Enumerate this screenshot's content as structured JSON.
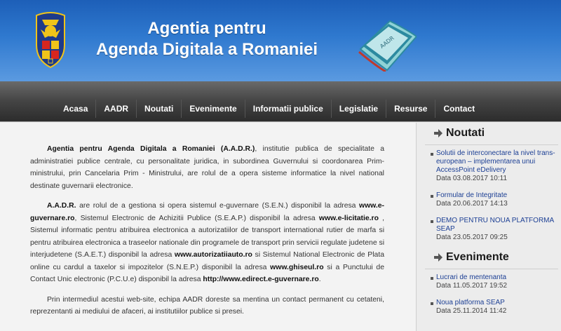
{
  "header": {
    "title_line1": "Agentia pentru",
    "title_line2": "Agenda Digitala a Romaniei",
    "logo_text": "AADR"
  },
  "nav": {
    "items": [
      "Acasa",
      "AADR",
      "Noutati",
      "Evenimente",
      "Informatii publice",
      "Legislatie",
      "Resurse",
      "Contact"
    ]
  },
  "content": {
    "p1": {
      "b1": "Agentia pentru Agenda Digitala a Romaniei (A.A.D.R.)",
      "t1": ",  institutie publica de specialitate a administratiei publice centrale, cu personalitate juridica, in subordinea Guvernului si coordonarea Prim-ministrului, prin Cancelaria Prim - Ministrului, are rolul de a opera sisteme informatice la nivel national destinate guvernarii electronice."
    },
    "p2": {
      "b1": "A.A.D.R.",
      "t1": " are rolul de a gestiona si opera sistemul e-guvernare (S.E.N.) disponibil la adresa ",
      "b2": "www.e-guvernare.ro",
      "t2": ", Sistemul Electronic de Achizitii Publice (S.E.A.P.) disponibil la adresa ",
      "b3": "www.e-licitatie.ro",
      "t3": " , Sistemul informatic pentru atribuirea electronica a autorizatiilor de transport international rutier de marfa si pentru atribuirea electronica a traseelor nationale din programele de transport prin servicii regulate judetene si interjudetene (S.A.E.T.) disponibil la adresa ",
      "b4": "www.autorizatiiauto.ro",
      "t4": " si Sistemul National Electronic de Plata online cu cardul a taxelor si impozitelor (S.N.E.P.) disponibil la adresa ",
      "b5": "www.ghiseul.ro",
      "t5": " si a Punctului de Contact Unic electronic (P.C.U.e) disponibil la adresa ",
      "b6": "http://www.edirect.e-guvernare.ro",
      "t6": "."
    },
    "p3": "Prin intermediul acestui web-site, echipa AADR doreste sa mentina un contact permanent cu cetateni, reprezentanti ai mediului de afaceri, ai institutiilor publice si presei."
  },
  "sidebar": {
    "news": {
      "heading": "Noutati",
      "items": [
        {
          "title": "Solutii de interconectare la nivel trans-european – implementarea unui AccessPoint eDelivery",
          "date": "Data 03.08.2017 10:11"
        },
        {
          "title": "Formular de Integritate",
          "date": "Data 20.06.2017 14:13"
        },
        {
          "title": "DEMO PENTRU NOUA PLATFORMA SEAP",
          "date": "Data 23.05.2017 09:25"
        }
      ]
    },
    "events": {
      "heading": "Evenimente",
      "items": [
        {
          "title": "Lucrari de mentenanta",
          "date": "Data 11.05.2017 19:52"
        },
        {
          "title": "Noua platforma SEAP",
          "date": "Data 25.11.2014 11:42"
        }
      ]
    }
  },
  "colors": {
    "header_blue": "#2f79cf",
    "nav_dark": "#3a3a3a",
    "link_blue": "#1c3f94"
  }
}
